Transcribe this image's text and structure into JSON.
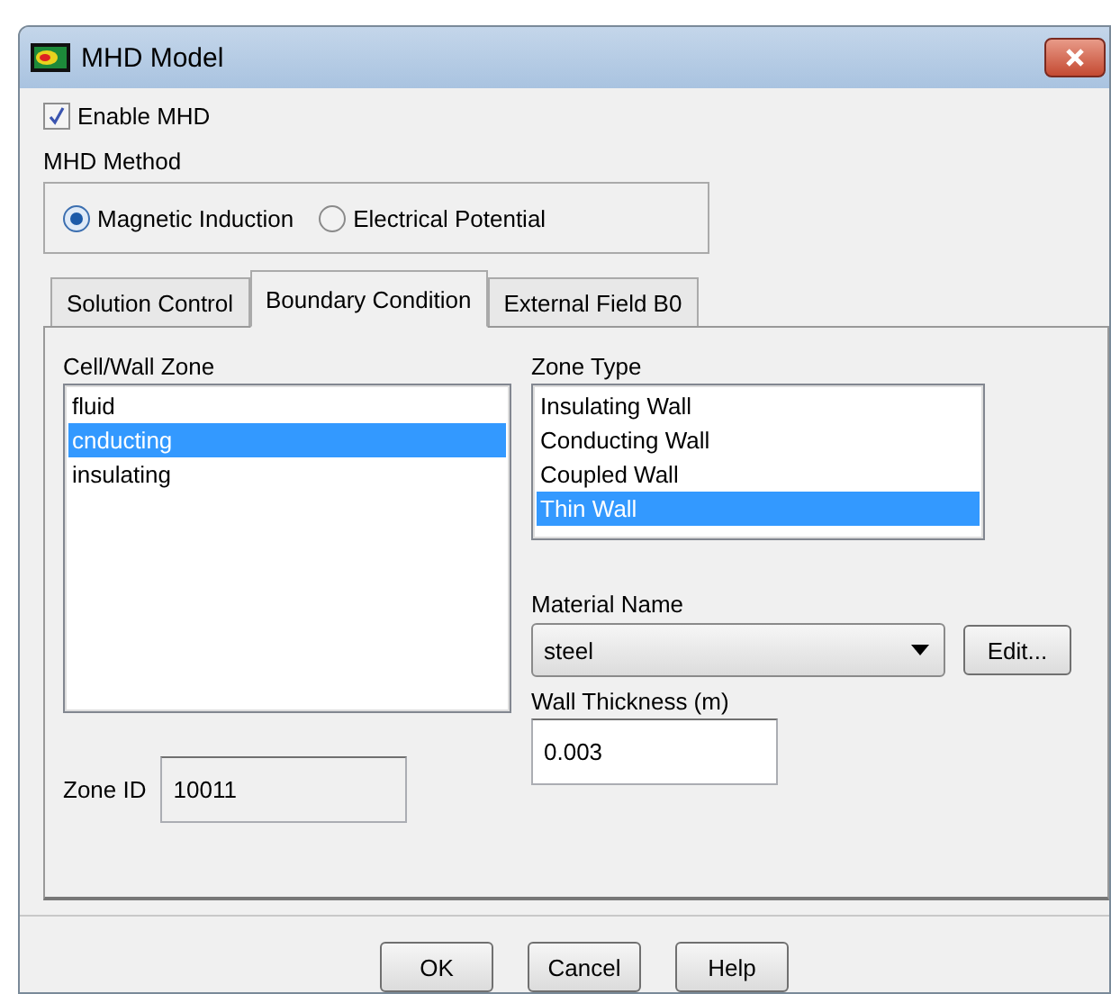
{
  "window": {
    "title": "MHD Model"
  },
  "enable_mhd": {
    "label": "Enable MHD",
    "checked": true
  },
  "mhd_method": {
    "label": "MHD Method",
    "options": [
      {
        "label": "Magnetic Induction",
        "selected": true
      },
      {
        "label": "Electrical Potential",
        "selected": false
      }
    ]
  },
  "tabs": [
    {
      "label": "Solution Control",
      "selected": false
    },
    {
      "label": "Boundary Condition",
      "selected": true
    },
    {
      "label": "External Field B0",
      "selected": false
    }
  ],
  "cell_wall_zone": {
    "label": "Cell/Wall Zone",
    "items": [
      {
        "label": "fluid",
        "selected": false
      },
      {
        "label": "cnducting",
        "selected": true
      },
      {
        "label": "insulating",
        "selected": false
      }
    ]
  },
  "zone_type": {
    "label": "Zone Type",
    "items": [
      {
        "label": "Insulating Wall",
        "selected": false
      },
      {
        "label": "Conducting Wall",
        "selected": false
      },
      {
        "label": "Coupled Wall",
        "selected": false
      },
      {
        "label": "Thin Wall",
        "selected": true
      }
    ]
  },
  "material_name": {
    "label": "Material Name",
    "value": "steel",
    "edit_button": "Edit..."
  },
  "wall_thickness": {
    "label": "Wall Thickness (m)",
    "value": "0.003"
  },
  "zone_id": {
    "label": "Zone ID",
    "value": "10011"
  },
  "buttons": [
    "OK",
    "Cancel",
    "Help"
  ]
}
